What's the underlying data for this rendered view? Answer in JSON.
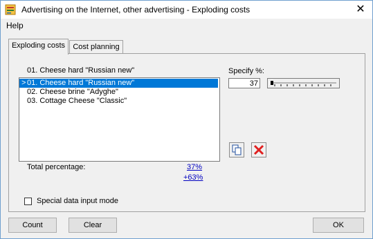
{
  "window": {
    "title": "Advertising on the Internet, other advertising - Exploding costs",
    "close_label": "✕"
  },
  "menu": {
    "help": "Help"
  },
  "tabs": [
    {
      "label": "Exploding costs",
      "active": true
    },
    {
      "label": "Cost planning",
      "active": false
    }
  ],
  "main": {
    "current_item": "01. Cheese hard \"Russian new\"",
    "list": [
      {
        "marker": ">",
        "label": "01. Cheese hard \"Russian new\"",
        "selected": true
      },
      {
        "marker": "",
        "label": "02. Cheese brine \"Adyghe\"",
        "selected": false
      },
      {
        "marker": "",
        "label": "03. Cottage Cheese \"Classic\"",
        "selected": false
      }
    ],
    "specify_label": "Specify %:",
    "specify_value": "37",
    "total_label": "Total percentage:",
    "total_value": "37%",
    "total_delta": "+63%",
    "special_mode_label": "Special data input mode",
    "special_mode_checked": false,
    "icons": {
      "copy": "copy-icon",
      "delete": "delete-x-icon"
    }
  },
  "buttons": {
    "count": "Count",
    "clear": "Clear",
    "ok": "OK"
  },
  "colors": {
    "selection": "#0078d7",
    "link": "#0000c0",
    "delete": "#e02020"
  }
}
